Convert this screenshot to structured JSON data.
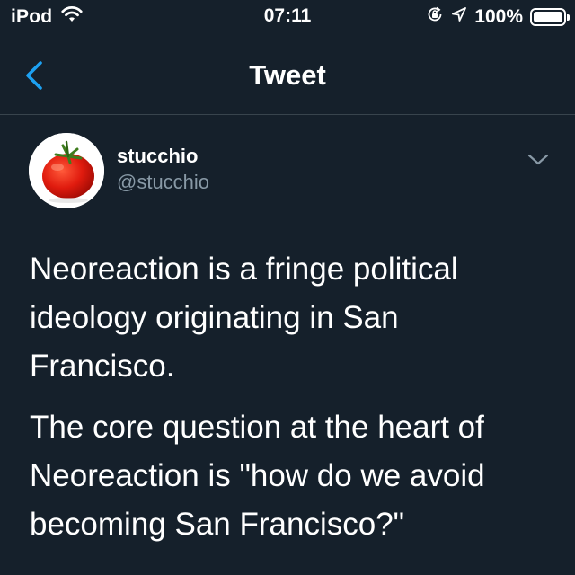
{
  "status_bar": {
    "carrier": "iPod",
    "time": "07:11",
    "battery_percent": "100%",
    "battery_level": 1.0,
    "icons": [
      "wifi-icon",
      "orientation-lock-icon",
      "location-icon",
      "battery-icon"
    ]
  },
  "nav": {
    "title": "Tweet",
    "back_icon": "chevron-left-icon"
  },
  "tweet": {
    "author": {
      "display_name": "stucchio",
      "handle": "@stucchio",
      "avatar": "tomato"
    },
    "paragraphs": [
      "Neoreaction is a fringe political ideology originating in San Francisco.",
      "The core question at the heart of Neoreaction is \"how do we avoid becoming San Francisco?\""
    ],
    "menu_icon": "chevron-down-icon"
  },
  "colors": {
    "background": "#15202b",
    "accent": "#1da1f2",
    "secondary_text": "#8899a6",
    "divider": "#38444d"
  }
}
